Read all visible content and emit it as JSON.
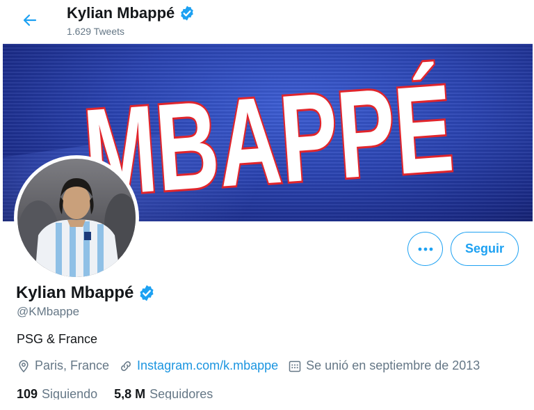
{
  "header": {
    "name": "Kylian Mbappé",
    "tweet_count": "1.629 Tweets"
  },
  "banner": {
    "text": "MBAPPÉ"
  },
  "actions": {
    "more_label": "•••",
    "follow_label": "Seguir"
  },
  "profile": {
    "name": "Kylian Mbappé",
    "handle": "@KMbappe",
    "bio": "PSG & France",
    "location": "Paris, France",
    "link": "Instagram.com/k.mbappe",
    "joined": "Se unió en septiembre de 2013"
  },
  "stats": {
    "following_count": "109",
    "following_label": "Siguiendo",
    "followers_count": "5,8 M",
    "followers_label": "Seguidores"
  },
  "colors": {
    "accent": "#1da1f2",
    "link": "#1b95e0",
    "muted": "#657786",
    "verified": "#1da1f2",
    "banner_blue": "#2a43b0",
    "banner_letters_red": "#e0252c"
  },
  "icons": {
    "back": "arrow-left-icon",
    "verified": "verified-badge-icon",
    "location": "location-pin-icon",
    "link": "link-icon",
    "calendar": "calendar-icon"
  }
}
